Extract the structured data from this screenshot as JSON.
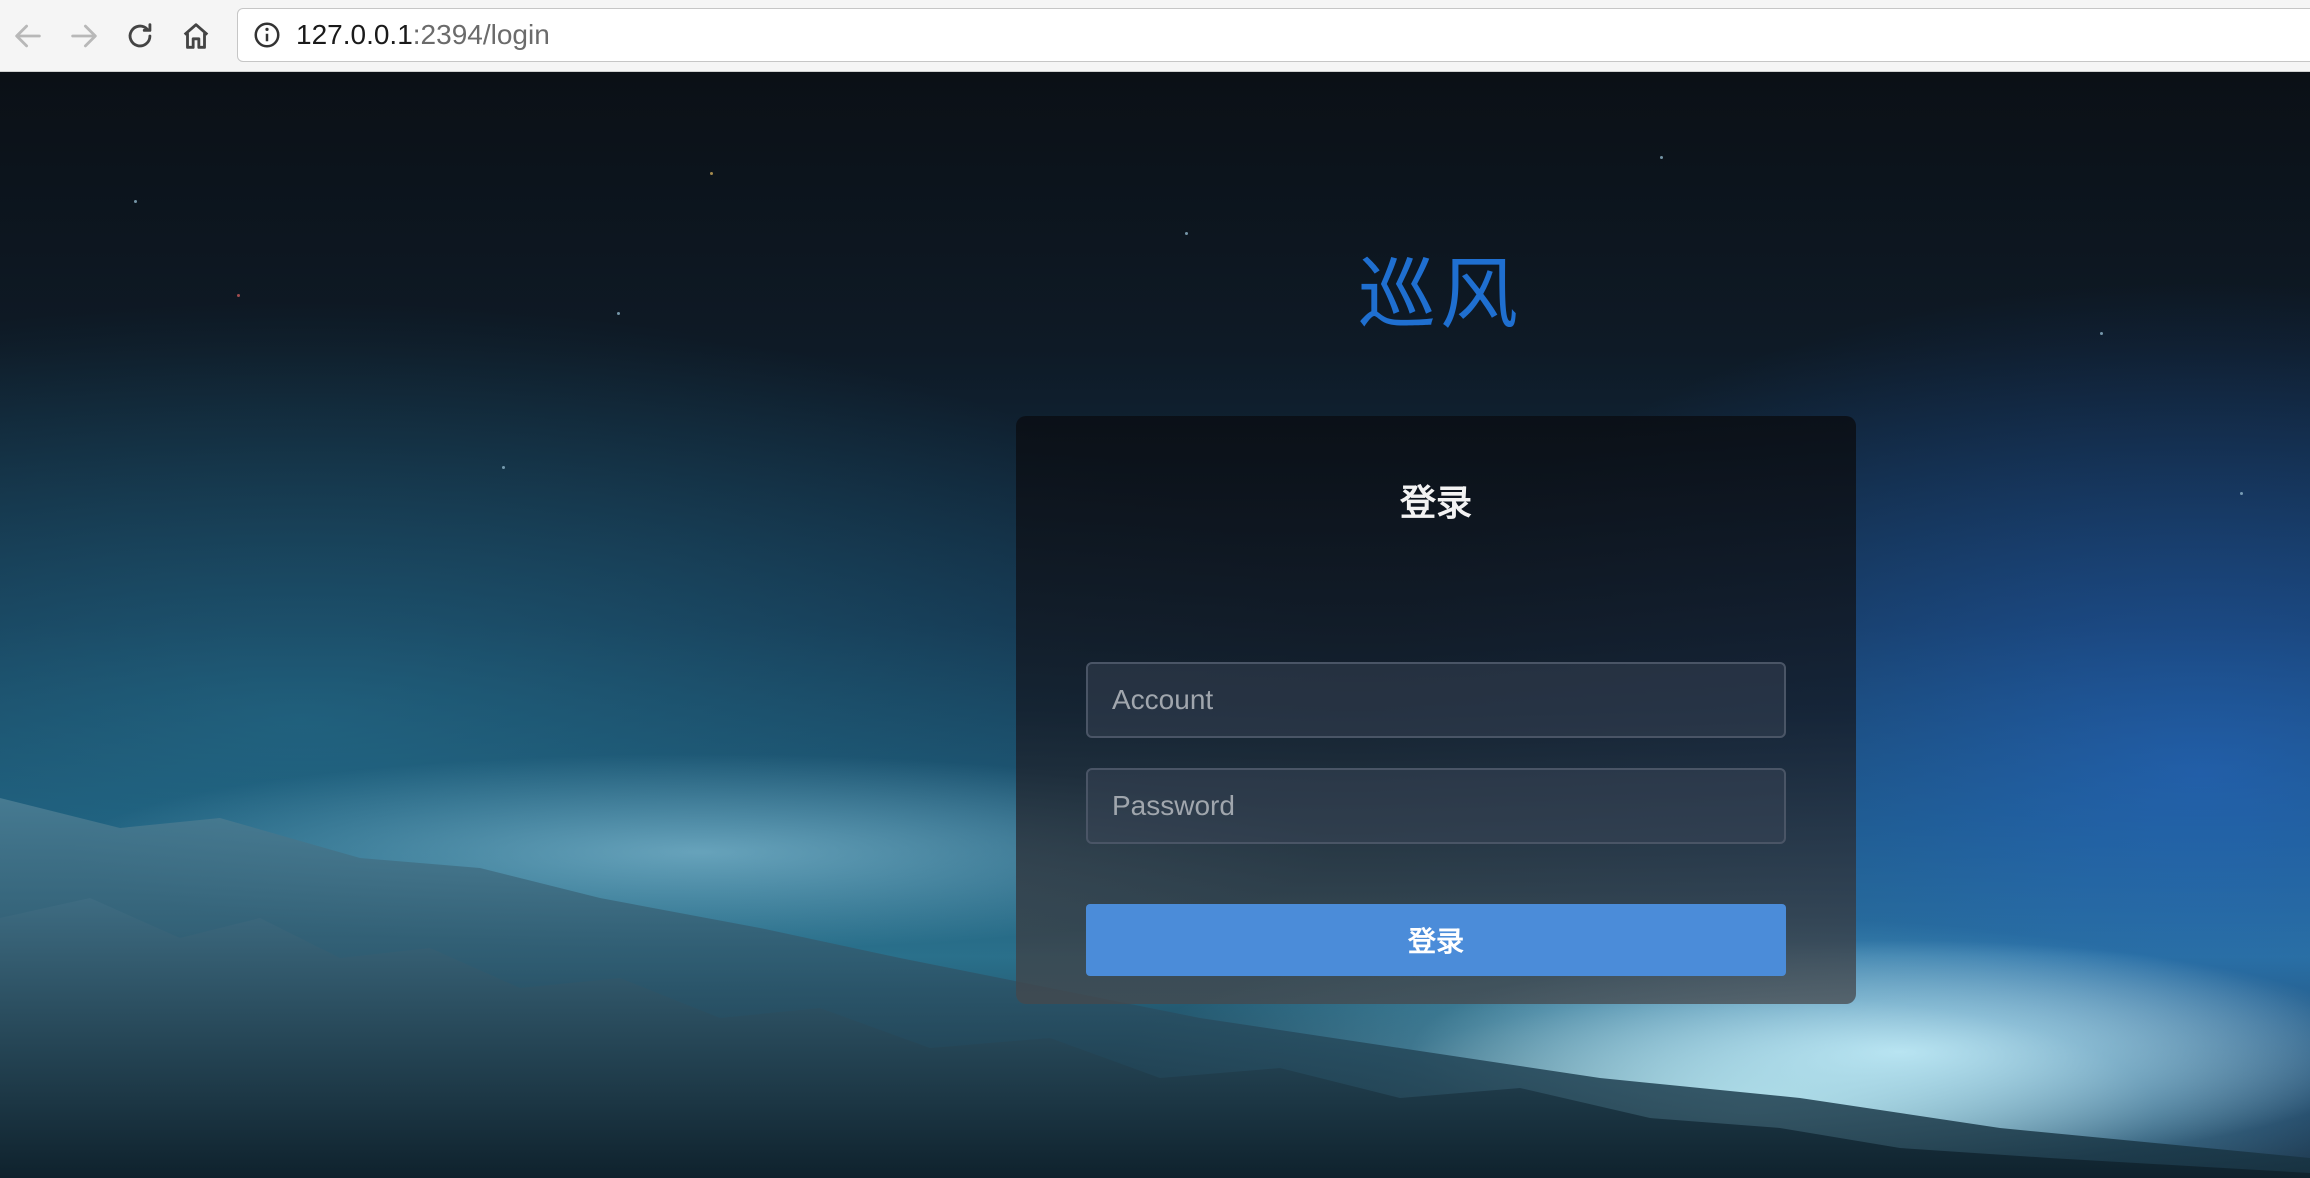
{
  "browser": {
    "url_host": "127.0.0.1",
    "url_rest": ":2394/login",
    "icons": [
      "back-arrow-icon",
      "forward-arrow-icon",
      "reload-icon",
      "home-icon",
      "info-icon"
    ]
  },
  "page": {
    "brand_title": "巡风",
    "login_card": {
      "title": "登录",
      "account_placeholder": "Account",
      "password_placeholder": "Password",
      "submit_label": "登录"
    }
  },
  "colors": {
    "brand_title": "#1f6fd0",
    "button": "#4b8cd9",
    "card_background": "#0a0e14"
  }
}
